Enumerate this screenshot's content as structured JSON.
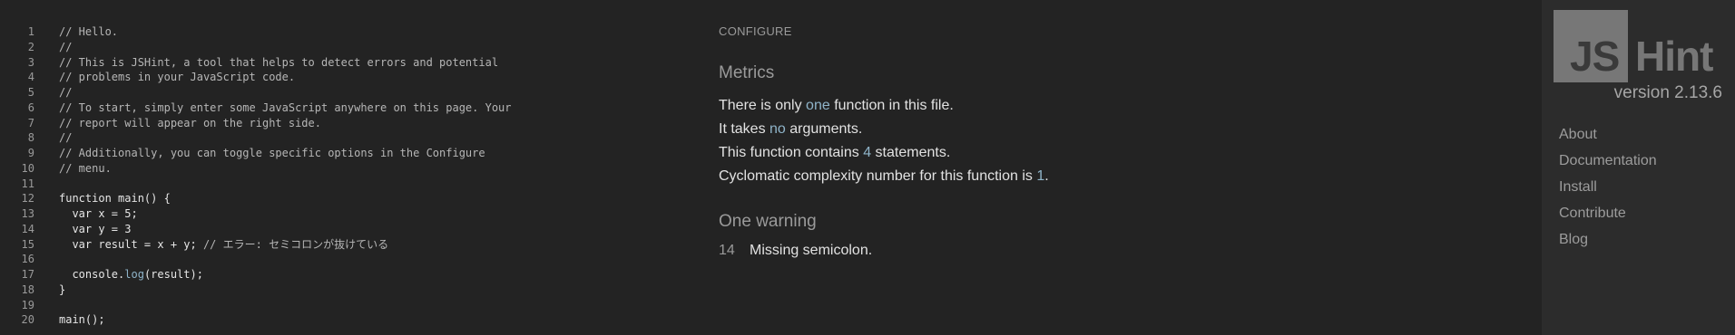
{
  "editor": {
    "lines": [
      {
        "num": "1",
        "segments": [
          {
            "cls": "tok-comment",
            "text": "// Hello."
          }
        ]
      },
      {
        "num": "2",
        "segments": [
          {
            "cls": "tok-comment",
            "text": "//"
          }
        ]
      },
      {
        "num": "3",
        "segments": [
          {
            "cls": "tok-comment",
            "text": "// This is JSHint, a tool that helps to detect errors and potential"
          }
        ]
      },
      {
        "num": "4",
        "segments": [
          {
            "cls": "tok-comment",
            "text": "// problems in your JavaScript code."
          }
        ]
      },
      {
        "num": "5",
        "segments": [
          {
            "cls": "tok-comment",
            "text": "//"
          }
        ]
      },
      {
        "num": "6",
        "segments": [
          {
            "cls": "tok-comment",
            "text": "// To start, simply enter some JavaScript anywhere on this page. Your"
          }
        ]
      },
      {
        "num": "7",
        "segments": [
          {
            "cls": "tok-comment",
            "text": "// report will appear on the right side."
          }
        ]
      },
      {
        "num": "8",
        "segments": [
          {
            "cls": "tok-comment",
            "text": "//"
          }
        ]
      },
      {
        "num": "9",
        "segments": [
          {
            "cls": "tok-comment",
            "text": "// Additionally, you can toggle specific options in the Configure"
          }
        ]
      },
      {
        "num": "10",
        "segments": [
          {
            "cls": "tok-comment",
            "text": "// menu."
          }
        ]
      },
      {
        "num": "11",
        "segments": []
      },
      {
        "num": "12",
        "segments": [
          {
            "cls": "tok-plain",
            "text": "function main() {"
          }
        ]
      },
      {
        "num": "13",
        "segments": [
          {
            "cls": "tok-plain",
            "text": "  var x = 5;"
          }
        ]
      },
      {
        "num": "14",
        "segments": [
          {
            "cls": "tok-plain",
            "text": "  var y = 3"
          }
        ]
      },
      {
        "num": "15",
        "segments": [
          {
            "cls": "tok-plain",
            "text": "  var result = x + y; "
          },
          {
            "cls": "tok-comment",
            "text": "// エラー: セミコロンが抜けている"
          }
        ]
      },
      {
        "num": "16",
        "segments": []
      },
      {
        "num": "17",
        "segments": [
          {
            "cls": "tok-plain",
            "text": "  console."
          },
          {
            "cls": "tok-fn",
            "text": "log"
          },
          {
            "cls": "tok-plain",
            "text": "(result);"
          }
        ]
      },
      {
        "num": "18",
        "segments": [
          {
            "cls": "tok-plain",
            "text": "}"
          }
        ]
      },
      {
        "num": "19",
        "segments": []
      },
      {
        "num": "20",
        "segments": [
          {
            "cls": "tok-plain",
            "text": "main();"
          }
        ]
      }
    ]
  },
  "report": {
    "configure_label": "CONFIGURE",
    "metrics_title": "Metrics",
    "metrics": [
      {
        "parts": [
          {
            "text": "There is only ",
            "hl": false
          },
          {
            "text": "one",
            "hl": true
          },
          {
            "text": " function in this file.",
            "hl": false
          }
        ]
      },
      {
        "parts": [
          {
            "text": "It takes ",
            "hl": false
          },
          {
            "text": "no",
            "hl": true
          },
          {
            "text": " arguments.",
            "hl": false
          }
        ]
      },
      {
        "parts": [
          {
            "text": "This function contains ",
            "hl": false
          },
          {
            "text": "4",
            "hl": true
          },
          {
            "text": " statements.",
            "hl": false
          }
        ]
      },
      {
        "parts": [
          {
            "text": "Cyclomatic complexity number for this function is ",
            "hl": false
          },
          {
            "text": "1",
            "hl": true
          },
          {
            "text": ".",
            "hl": false
          }
        ]
      }
    ],
    "warnings_title": "One warning",
    "warnings": [
      {
        "line": "14",
        "message": "Missing semicolon."
      }
    ]
  },
  "sidebar": {
    "logo_left": "JS",
    "logo_right": "Hint",
    "version": "version 2.13.6",
    "nav": [
      {
        "label": "About",
        "name": "nav-about"
      },
      {
        "label": "Documentation",
        "name": "nav-documentation"
      },
      {
        "label": "Install",
        "name": "nav-install"
      },
      {
        "label": "Contribute",
        "name": "nav-contribute"
      },
      {
        "label": "Blog",
        "name": "nav-blog"
      }
    ]
  },
  "colors": {
    "background": "#232323",
    "sidebar_background": "#2c2c2c",
    "accent": "#8fb4c9",
    "logo_gray": "#777777"
  }
}
